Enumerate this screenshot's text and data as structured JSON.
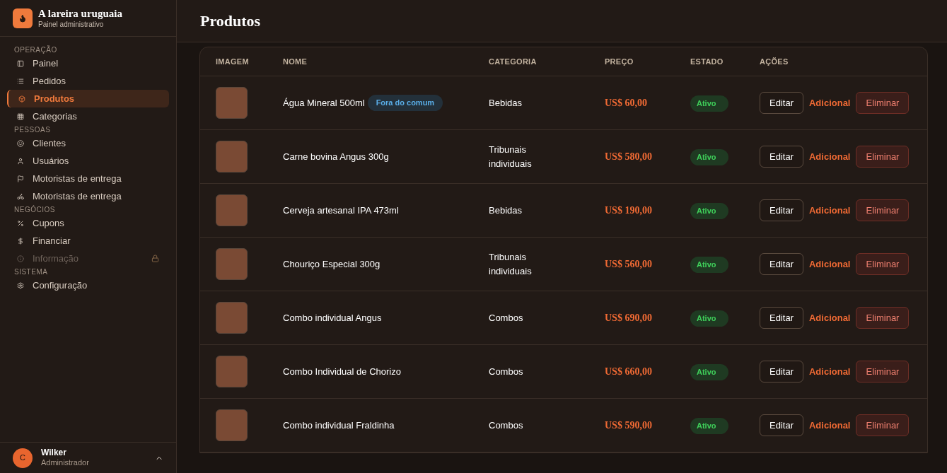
{
  "brand": {
    "title": "A lareira uruguaia",
    "subtitle": "Painel administrativo"
  },
  "sidebar": {
    "sections": [
      {
        "title": "OPERAÇÃO",
        "items": [
          {
            "label": "Painel",
            "kind": "panel",
            "selected": false,
            "disabled": false
          },
          {
            "label": "Pedidos",
            "kind": "list",
            "selected": false,
            "disabled": false
          },
          {
            "label": "Produtos",
            "kind": "box",
            "selected": true,
            "disabled": false
          },
          {
            "label": "Categorias",
            "kind": "grid",
            "selected": false,
            "disabled": false
          }
        ]
      },
      {
        "title": "PESSOAS",
        "items": [
          {
            "label": "Clientes",
            "kind": "smile",
            "selected": false,
            "disabled": false
          },
          {
            "label": "Usuários",
            "kind": "user",
            "selected": false,
            "disabled": false
          },
          {
            "label": "Motoristas de entrega",
            "kind": "flag",
            "selected": false,
            "disabled": false
          },
          {
            "label": "Motoristas de entrega",
            "kind": "scooter",
            "selected": false,
            "disabled": false
          }
        ]
      },
      {
        "title": "NEGÓCIOS",
        "items": [
          {
            "label": "Cupons",
            "kind": "percent",
            "selected": false,
            "disabled": false
          },
          {
            "label": "Financiar",
            "kind": "dollar",
            "selected": false,
            "disabled": false
          },
          {
            "label": "Informação",
            "kind": "info",
            "selected": false,
            "disabled": true
          }
        ]
      },
      {
        "title": "SISTEMA",
        "items": [
          {
            "label": "Configuração",
            "kind": "gear",
            "selected": false,
            "disabled": false
          }
        ]
      }
    ]
  },
  "user": {
    "initial": "C",
    "name": "Wilker",
    "role": "Administrador"
  },
  "page": {
    "title": "Produtos"
  },
  "table": {
    "columns": [
      "IMAGEM",
      "NOME",
      "CATEGORIA",
      "PREÇO",
      "ESTADO",
      "AÇÕES"
    ],
    "rows": [
      {
        "name": "Água Mineral 500ml",
        "tag": "Fora do comum",
        "category": "Bebidas",
        "price": "US$ 60,00",
        "status": {
          "label": "Ativo",
          "active": true
        },
        "actions": [
          "Editar",
          "Adicional",
          "Eliminar"
        ]
      },
      {
        "name": "Carne bovina Angus 300g",
        "category": "Tribunais individuais",
        "price": "US$ 580,00",
        "status": {
          "label": "Ativo",
          "active": true
        },
        "actions": [
          "Editar",
          "Adicional",
          "Eliminar"
        ]
      },
      {
        "name": "Cerveja artesanal IPA 473ml",
        "category": "Bebidas",
        "price": "US$ 190,00",
        "status": {
          "label": "Ativo",
          "active": true
        },
        "actions": [
          "Editar",
          "Adicional",
          "Eliminar"
        ]
      },
      {
        "name": "Chouriço Especial 300g",
        "category": "Tribunais individuais",
        "price": "US$ 560,00",
        "status": {
          "label": "Ativo",
          "active": true
        },
        "actions": [
          "Editar",
          "Adicional",
          "Eliminar"
        ]
      },
      {
        "name": "Combo individual Angus",
        "category": "Combos",
        "price": "US$ 690,00",
        "status": {
          "label": "Ativo",
          "active": true
        },
        "actions": [
          "Editar",
          "Adicional",
          "Eliminar"
        ]
      },
      {
        "name": "Combo Individual de Chorizo",
        "category": "Combos",
        "price": "US$ 660,00",
        "status": {
          "label": "Ativo",
          "active": true
        },
        "actions": [
          "Editar",
          "Adicional",
          "Eliminar"
        ]
      },
      {
        "name": "Combo individual Fraldinha",
        "category": "Combos",
        "price": "US$ 590,00",
        "status": {
          "label": "Ativo",
          "active": true
        },
        "actions": [
          "Editar",
          "Adicional",
          "Eliminar"
        ]
      }
    ]
  }
}
